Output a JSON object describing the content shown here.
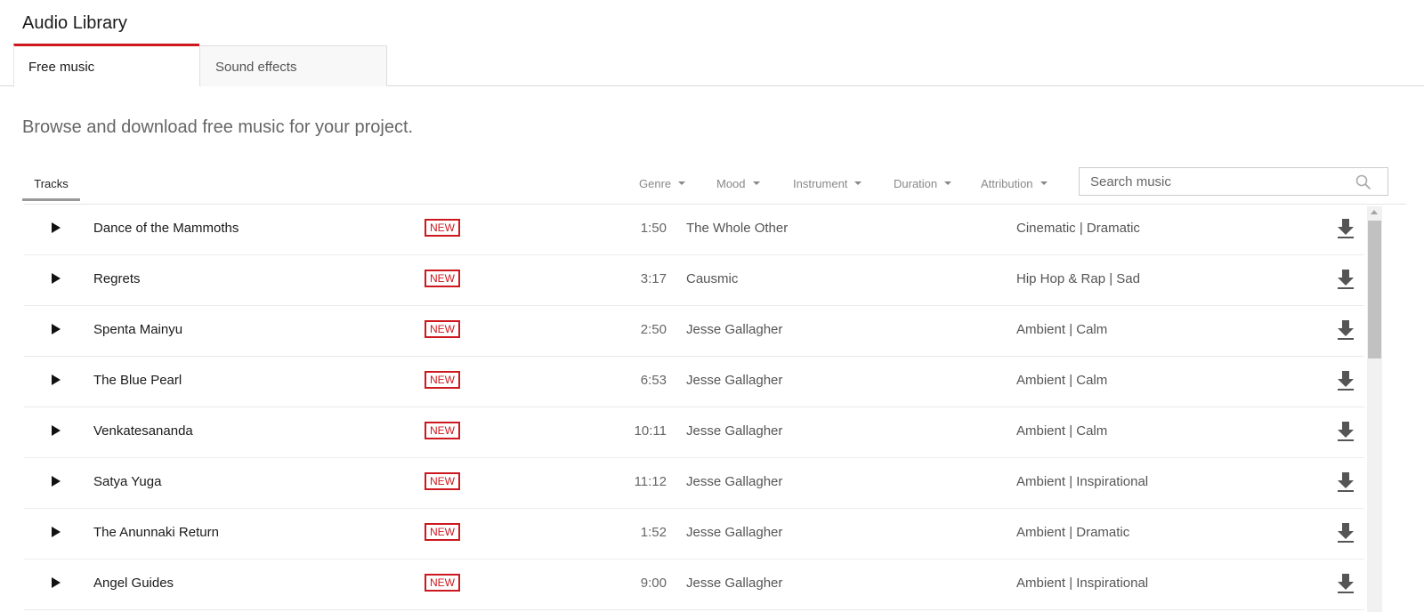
{
  "header": {
    "title": "Audio Library"
  },
  "tabs": [
    {
      "label": "Free music",
      "active": true
    },
    {
      "label": "Sound effects",
      "active": false
    }
  ],
  "subtitle": "Browse and download free music for your project.",
  "toolbar": {
    "tracks_label": "Tracks",
    "filters": [
      "Genre",
      "Mood",
      "Instrument",
      "Duration",
      "Attribution"
    ],
    "search": {
      "placeholder": "Search music",
      "value": ""
    }
  },
  "badge_label": "NEW",
  "colors": {
    "accent": "#cc181e",
    "badge": "#cc181e"
  },
  "tracks": [
    {
      "title": "Dance of the Mammoths",
      "badge": "NEW",
      "duration": "1:50",
      "artist": "The Whole Other",
      "genre_mood": "Cinematic | Dramatic"
    },
    {
      "title": "Regrets",
      "badge": "NEW",
      "duration": "3:17",
      "artist": "Causmic",
      "genre_mood": "Hip Hop & Rap | Sad"
    },
    {
      "title": "Spenta Mainyu",
      "badge": "NEW",
      "duration": "2:50",
      "artist": "Jesse Gallagher",
      "genre_mood": "Ambient | Calm"
    },
    {
      "title": "The Blue Pearl",
      "badge": "NEW",
      "duration": "6:53",
      "artist": "Jesse Gallagher",
      "genre_mood": "Ambient | Calm"
    },
    {
      "title": "Venkatesananda",
      "badge": "NEW",
      "duration": "10:11",
      "artist": "Jesse Gallagher",
      "genre_mood": "Ambient | Calm"
    },
    {
      "title": "Satya Yuga",
      "badge": "NEW",
      "duration": "11:12",
      "artist": "Jesse Gallagher",
      "genre_mood": "Ambient | Inspirational"
    },
    {
      "title": "The Anunnaki Return",
      "badge": "NEW",
      "duration": "1:52",
      "artist": "Jesse Gallagher",
      "genre_mood": "Ambient | Dramatic"
    },
    {
      "title": "Angel Guides",
      "badge": "NEW",
      "duration": "9:00",
      "artist": "Jesse Gallagher",
      "genre_mood": "Ambient | Inspirational"
    }
  ]
}
